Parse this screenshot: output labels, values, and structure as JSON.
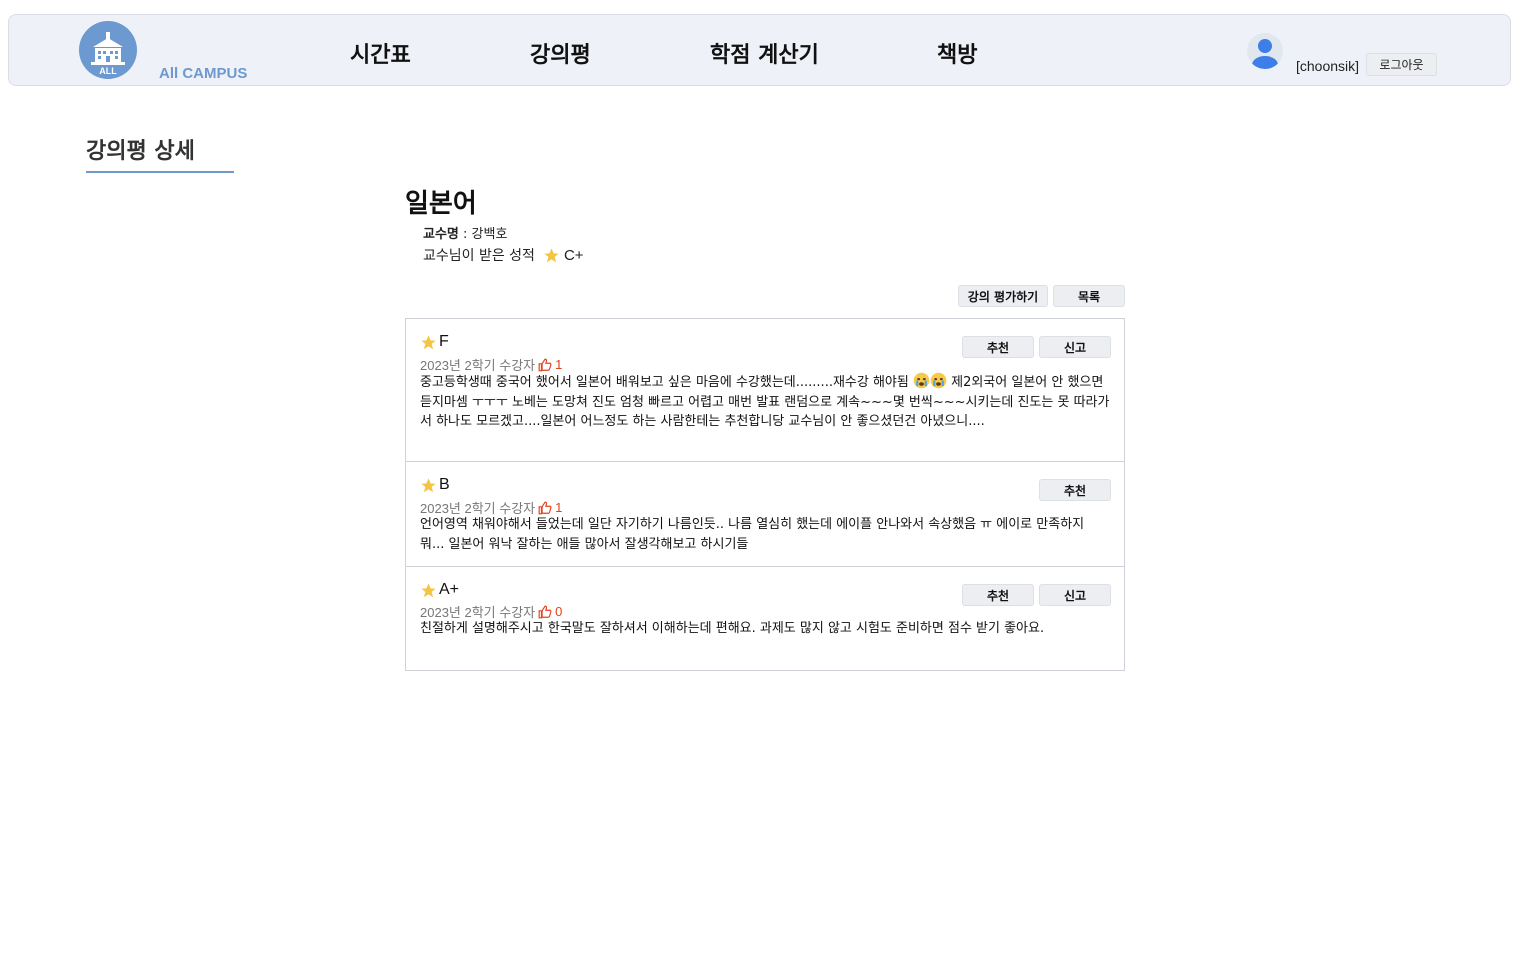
{
  "header": {
    "logo_badge": "ALL",
    "logo_text": "All CAMPUS",
    "nav": [
      "시간표",
      "강의평",
      "학점 계산기",
      "책방"
    ],
    "username": "[choonsik]",
    "logout_label": "로그아웃"
  },
  "section_title": "강의평 상세",
  "course": {
    "title": "일본어",
    "professor_label": "교수명",
    "professor_sep": " : ",
    "professor_name": "강백호",
    "grade_label": "교수님이 받은 성적",
    "grade_value": "C+"
  },
  "actions": {
    "evaluate_label": "강의 평가하기",
    "list_label": "목록"
  },
  "colors": {
    "accent": "#6c99cf",
    "star": "#f4c542",
    "like": "#e0421c"
  },
  "reviews": [
    {
      "grade": "F",
      "semester": "2023년 2학기 수강자",
      "likes": "1",
      "recommend_label": "추천",
      "report_label": "신고",
      "text_part1": "중고등학생때 중국어 했어서 일본어 배워보고 싶은 마음에 수강했는데.........재수강 해야됨 ",
      "emoji": "crying-face-icon",
      "text_part2": " 제2외국어 일본어 안 했으면 듣지마셈 ㅜㅜㅜ 노베는 도망쳐 진도 엄청 빠르고 어렵고 매번 발표 랜덤으로 계속~~~몇 번씩~~~시키는데 진도는 못 따라가서 하나도 모르겠고....일본어 어느정도 하는 사람한테는 추천합니당 교수님이 안 좋으셨던건 아녔으니...."
    },
    {
      "grade": "B",
      "semester": "2023년 2학기 수강자",
      "likes": "1",
      "recommend_label": "추천",
      "text": "언어영역 채워야해서 들었는데 일단 자기하기 나름인듯.. 나름 열심히 했는데 에이플 안나와서 속상했음 ㅠ 에이로 만족하지 뭐... 일본어 워낙 잘하는 애들 많아서 잘생각해보고 하시기들"
    },
    {
      "grade": "A+",
      "semester": "2023년 2학기 수강자",
      "likes": "0",
      "recommend_label": "추천",
      "report_label": "신고",
      "text": "친절하게 설명해주시고 한국말도 잘하셔서 이해하는데 편해요. 과제도 많지 않고 시험도 준비하면 점수 받기 좋아요."
    }
  ]
}
